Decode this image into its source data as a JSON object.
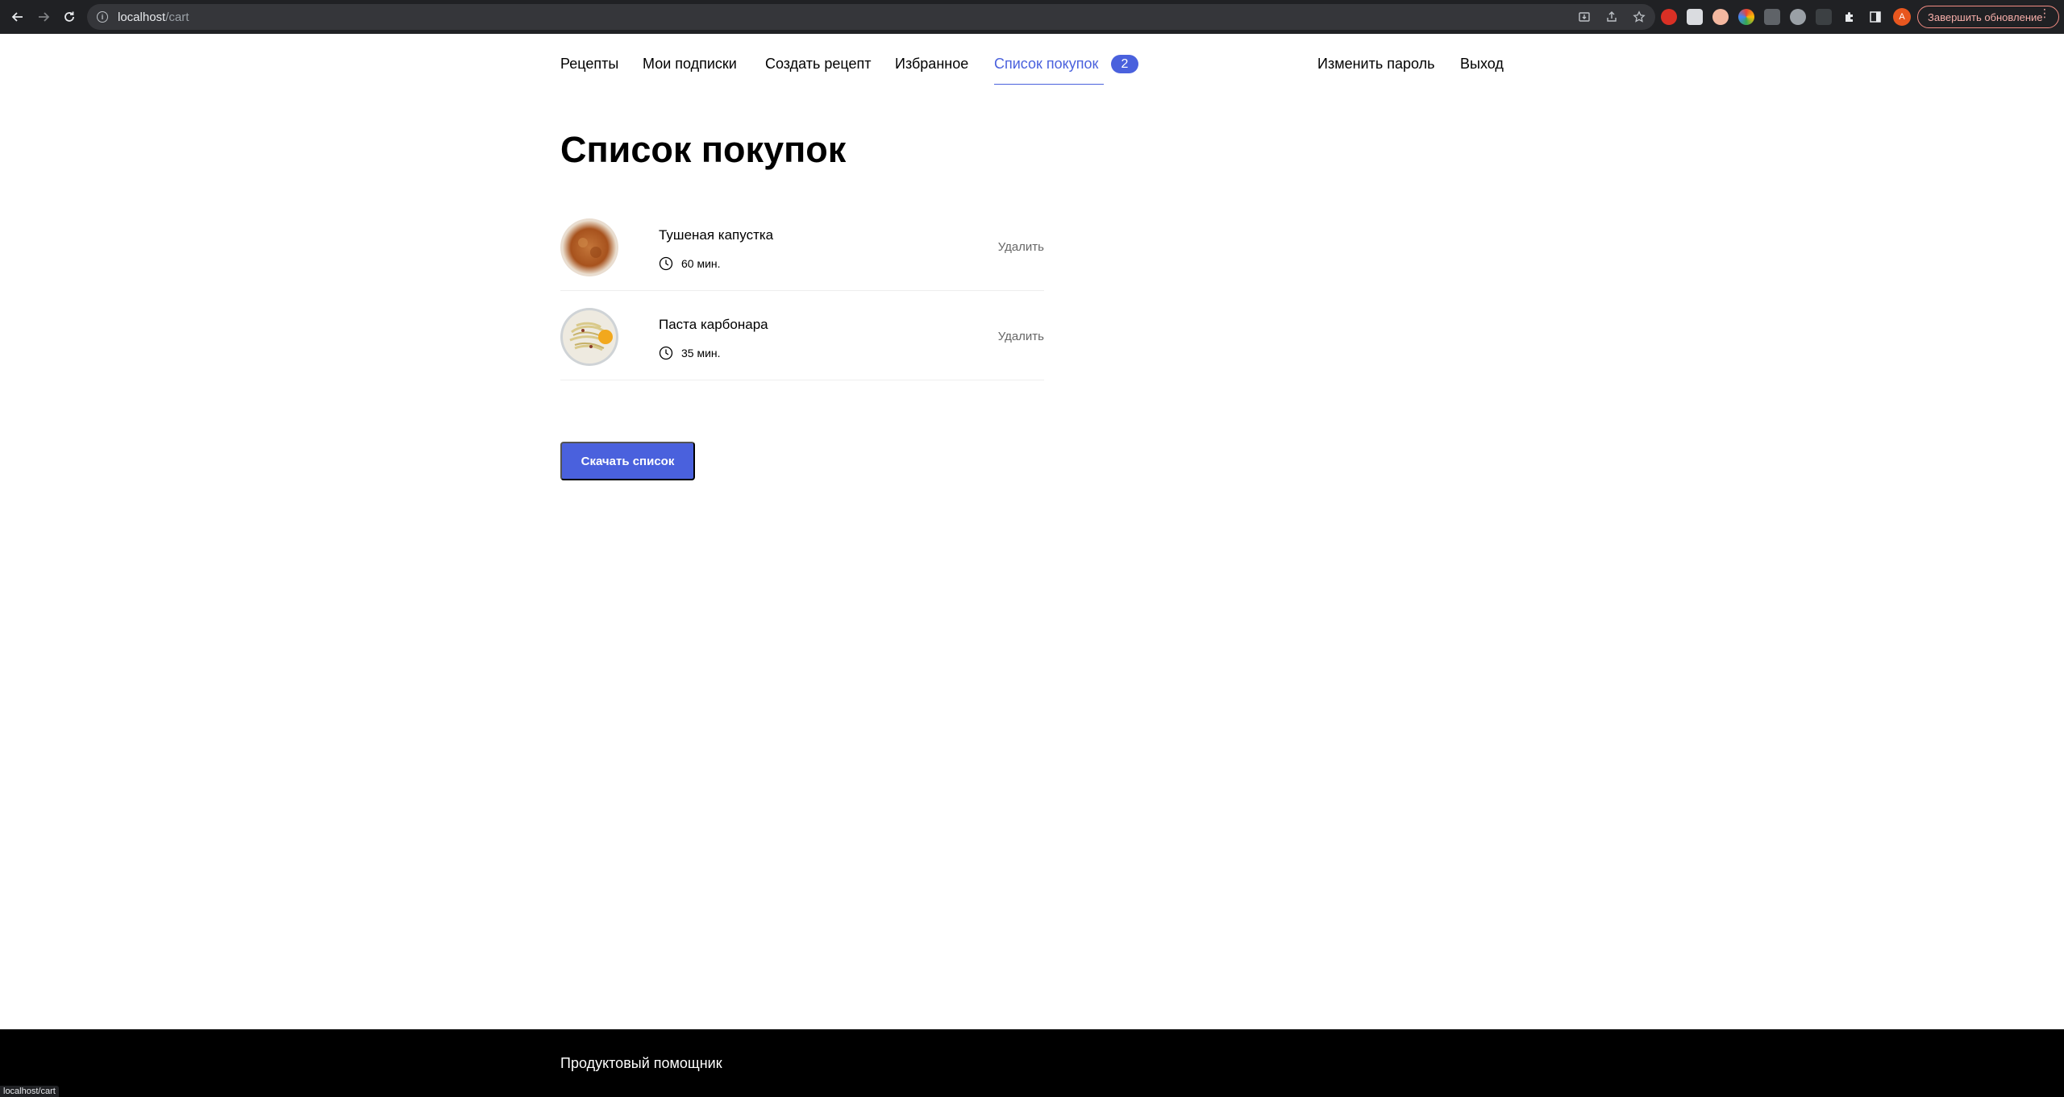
{
  "browser": {
    "url_host": "localhost",
    "url_path": "/cart",
    "update_button": "Завершить обновление",
    "profile_initial": "A",
    "status_url": "localhost/cart"
  },
  "nav": {
    "recipes": "Рецепты",
    "subscriptions": "Мои подписки",
    "create_recipe": "Создать рецепт",
    "favorites": "Избранное",
    "shopping_list": "Список покупок",
    "shopping_count": "2",
    "change_password": "Изменить пароль",
    "logout": "Выход"
  },
  "page": {
    "title": "Список покупок",
    "download_label": "Скачать список"
  },
  "items": [
    {
      "title": "Тушеная капустка",
      "time": "60 мин.",
      "remove_label": "Удалить"
    },
    {
      "title": "Паста карбонара",
      "time": "35 мин.",
      "remove_label": "Удалить"
    }
  ],
  "footer": {
    "title": "Продуктовый помощник"
  },
  "colors": {
    "accent": "#4a61dd",
    "chrome_bg": "#202124",
    "footer_bg": "#000000"
  }
}
